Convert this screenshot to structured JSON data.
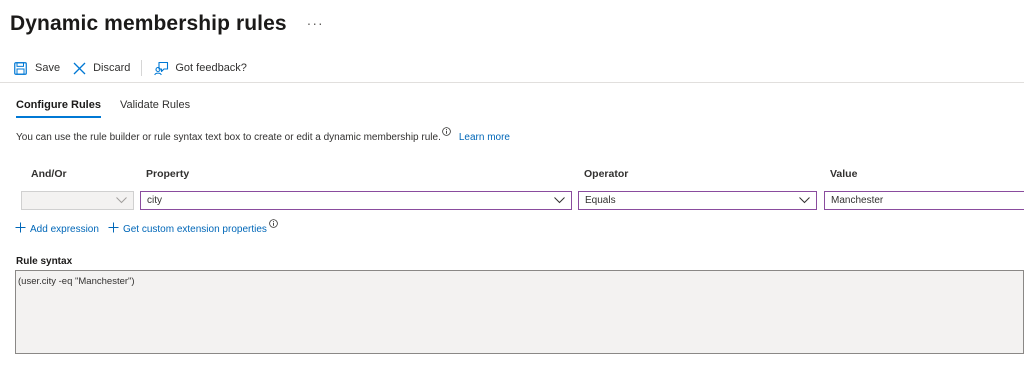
{
  "header": {
    "title": "Dynamic membership rules",
    "more_label": "···"
  },
  "toolbar": {
    "save_label": "Save",
    "discard_label": "Discard",
    "feedback_label": "Got feedback?"
  },
  "tabs": [
    {
      "label": "Configure Rules",
      "active": true
    },
    {
      "label": "Validate Rules",
      "active": false
    }
  ],
  "description": {
    "text": "You can use the rule builder or rule syntax text box to create or edit a dynamic membership rule.",
    "learn_more": "Learn more"
  },
  "rule_table": {
    "headers": {
      "and_or": "And/Or",
      "property": "Property",
      "operator": "Operator",
      "value": "Value"
    },
    "row": {
      "and_or": "",
      "property": "city",
      "operator": "Equals",
      "value": "Manchester"
    }
  },
  "actions": {
    "add_expression": "Add expression",
    "custom_ext": "Get custom extension properties"
  },
  "rule_syntax": {
    "label": "Rule syntax",
    "value": "(user.city -eq \"Manchester\")"
  },
  "colors": {
    "accent": "#0078d4",
    "link": "#0067b8",
    "field_border": "#8a4c9e"
  },
  "icons": [
    "save-icon",
    "close-icon",
    "feedback-icon",
    "info-icon",
    "chevron-down-icon",
    "add-icon"
  ]
}
